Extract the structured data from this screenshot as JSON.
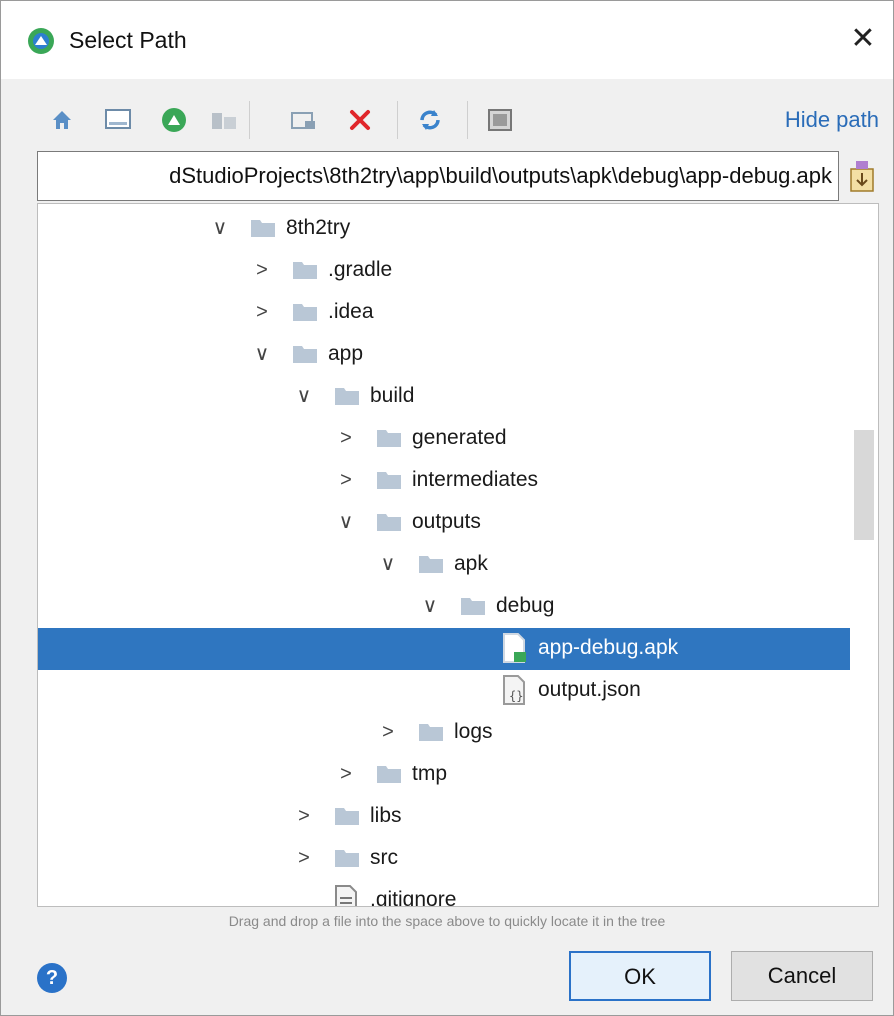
{
  "window": {
    "title": "Select Path",
    "close_glyph": "✕"
  },
  "toolbar": {
    "icons": [
      "home-icon",
      "desktop-icon",
      "android-project-icon",
      "module-icon",
      "new-folder-icon",
      "delete-icon",
      "refresh-icon",
      "show-hidden-icon"
    ],
    "hide_path_label": "Hide path"
  },
  "path": {
    "value": "dStudioProjects\\8th2try\\app\\build\\outputs\\apk\\debug\\app-debug.apk"
  },
  "tree": {
    "rows": [
      {
        "label": "8th2try",
        "arrow": "∨",
        "kind": "folder"
      },
      {
        "label": ".gradle",
        "arrow": ">",
        "kind": "folder"
      },
      {
        "label": ".idea",
        "arrow": ">",
        "kind": "folder"
      },
      {
        "label": "app",
        "arrow": "∨",
        "kind": "folder"
      },
      {
        "label": "build",
        "arrow": "∨",
        "kind": "folder"
      },
      {
        "label": "generated",
        "arrow": ">",
        "kind": "folder"
      },
      {
        "label": "intermediates",
        "arrow": ">",
        "kind": "folder"
      },
      {
        "label": "outputs",
        "arrow": "∨",
        "kind": "folder"
      },
      {
        "label": "apk",
        "arrow": "∨",
        "kind": "folder"
      },
      {
        "label": "debug",
        "arrow": "∨",
        "kind": "folder"
      },
      {
        "label": "app-debug.apk",
        "arrow": "",
        "kind": "apk",
        "selected": true
      },
      {
        "label": "output.json",
        "arrow": "",
        "kind": "json"
      },
      {
        "label": "logs",
        "arrow": ">",
        "kind": "folder"
      },
      {
        "label": "tmp",
        "arrow": ">",
        "kind": "folder"
      },
      {
        "label": "libs",
        "arrow": ">",
        "kind": "folder"
      },
      {
        "label": "src",
        "arrow": ">",
        "kind": "folder"
      },
      {
        "label": ".gitignore",
        "arrow": "",
        "kind": "file"
      }
    ]
  },
  "hint": "Drag and drop a file into the space above to quickly locate it in the tree",
  "footer": {
    "help_glyph": "?",
    "ok_label": "OK",
    "cancel_label": "Cancel"
  },
  "colors": {
    "selection": "#2f76c0",
    "link": "#2a6cb8",
    "folder": "#b9c7d6",
    "android_green": "#3aa757",
    "delete_red": "#e0262a"
  }
}
